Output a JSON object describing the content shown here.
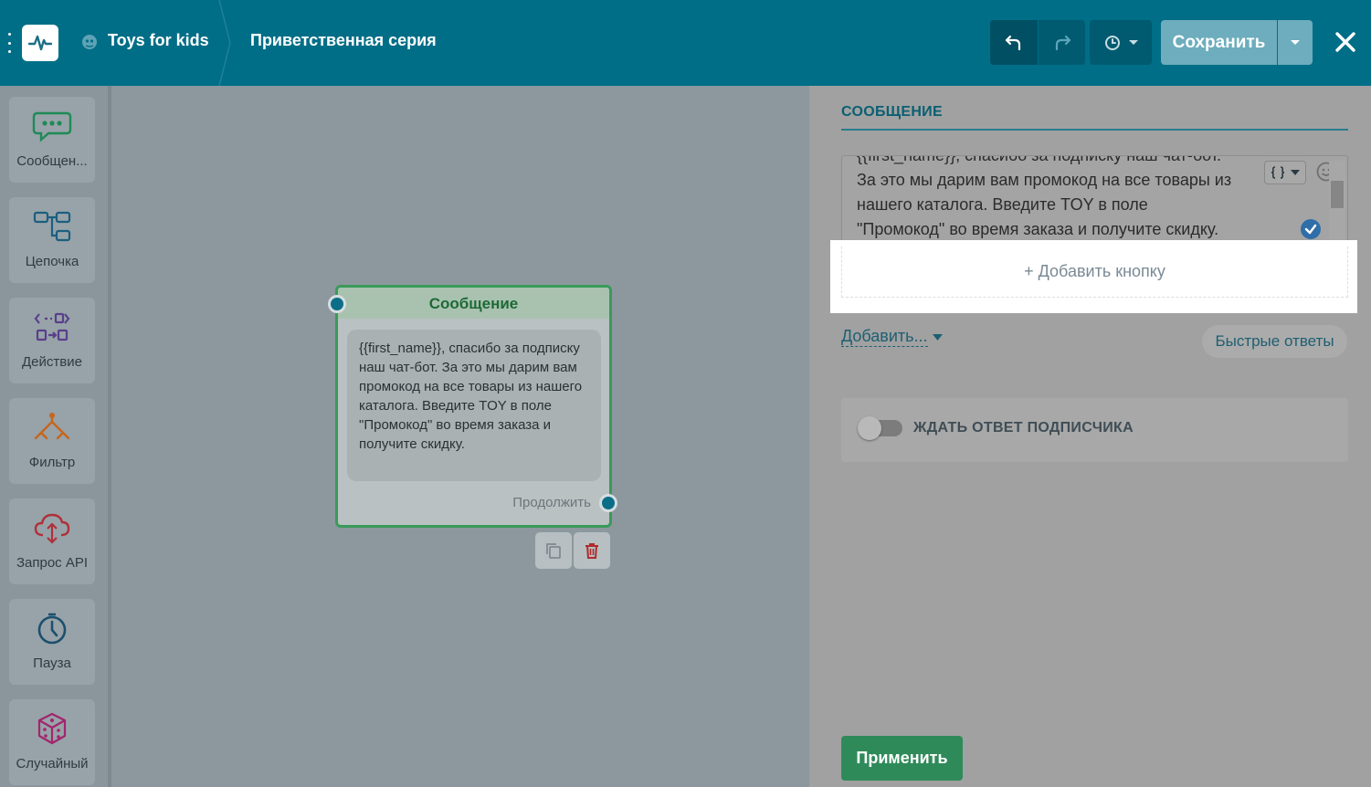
{
  "header": {
    "project_name": "Toys for kids",
    "flow_name": "Приветственная серия",
    "save_label": "Сохранить"
  },
  "sidebar": {
    "items": [
      {
        "label": "Сообщен...",
        "icon": "chat-bubble-icon",
        "color": "#1f8a56"
      },
      {
        "label": "Цепочка",
        "icon": "chain-icon",
        "color": "#1b5f80"
      },
      {
        "label": "Действие",
        "icon": "action-icon",
        "color": "#5a3f8c"
      },
      {
        "label": "Фильтр",
        "icon": "filter-icon",
        "color": "#c8651c"
      },
      {
        "label": "Запрос API",
        "icon": "cloud-api-icon",
        "color": "#b0303a"
      },
      {
        "label": "Пауза",
        "icon": "timer-icon",
        "color": "#1c4f6e"
      },
      {
        "label": "Случайный",
        "icon": "dice-icon",
        "color": "#a3246e"
      }
    ]
  },
  "node": {
    "title": "Сообщение",
    "text": "{{first_name}}, спасибо за подписку наш чат-бот. За это мы дарим вам промокод на все товары из нашего каталога. Введите TOY в поле \"Промокод\" во время заказа и получите скидку.",
    "continue_label": "Продолжить"
  },
  "panel": {
    "title": "СООБЩЕНИЕ",
    "message_first_line": "{{first_name}}, спасибо за подписку наш чат-бот.",
    "message_lines": [
      "За это мы дарим вам промокод на все товары из",
      "нашего каталога. Введите TOY в поле",
      "\"Промокод\" во время заказа и получите скидку."
    ],
    "add_button_label": "+ Добавить кнопку",
    "add_more_label": "Добавить...",
    "quick_replies_label": "Быстрые ответы",
    "wait_reply_label": "ЖДАТЬ ОТВЕТ ПОДПИСЧИКА",
    "wait_reply_enabled": false,
    "apply_label": "Применить"
  },
  "colors": {
    "topbar": "#006e87",
    "accent_green": "#2f8a5a",
    "link": "#1e5f72"
  }
}
